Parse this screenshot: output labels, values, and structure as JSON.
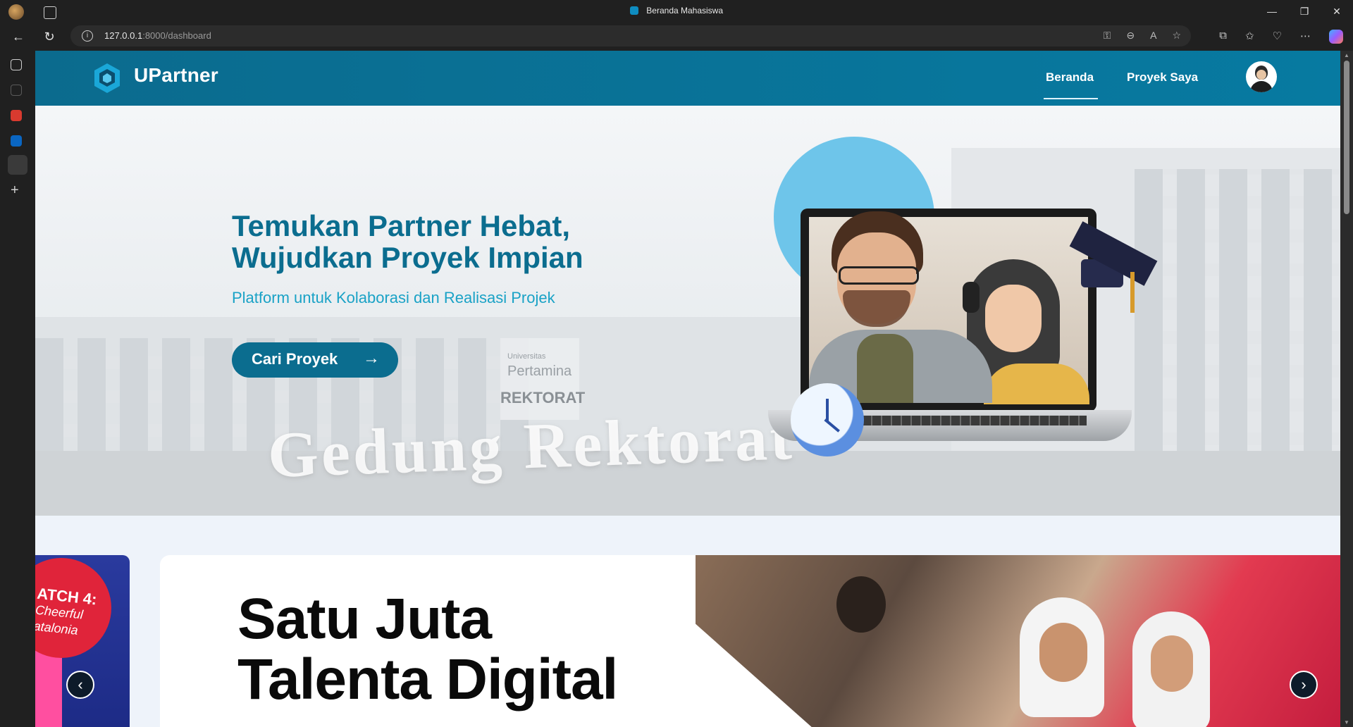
{
  "browser": {
    "tab_title": "Beranda Mahasiswa",
    "url_host": "127.0.0.1",
    "url_rest": ":8000/dashboard",
    "window_controls": [
      "—",
      "❐",
      "✕"
    ]
  },
  "navbar": {
    "brand": "UPartner",
    "links": [
      {
        "label": "Beranda",
        "active": true
      },
      {
        "label": "Proyek Saya",
        "active": false
      }
    ],
    "accent_color": "#0b6d8f"
  },
  "hero": {
    "title_line1": "Temukan Partner Hebat,",
    "title_line2": "Wujudkan Proyek Impian",
    "subtitle": "Platform untuk Kolaborasi dan Realisasi Projek",
    "cta_label": "Cari Proyek",
    "cta_arrow": "→",
    "background_text": "Gedung Rektorat",
    "sign_lines": [
      "Universitas",
      "Pertamina",
      "REKTORAT"
    ]
  },
  "carousel": {
    "prev_slide_text_line1": "ATCH 4:",
    "prev_slide_text_line2": "Cheerful",
    "prev_slide_text_line3": "atalonia",
    "main_headline_line1": "Satu Juta",
    "main_headline_line2": "Talenta Digital",
    "prev_button": "‹",
    "next_button": "›"
  }
}
